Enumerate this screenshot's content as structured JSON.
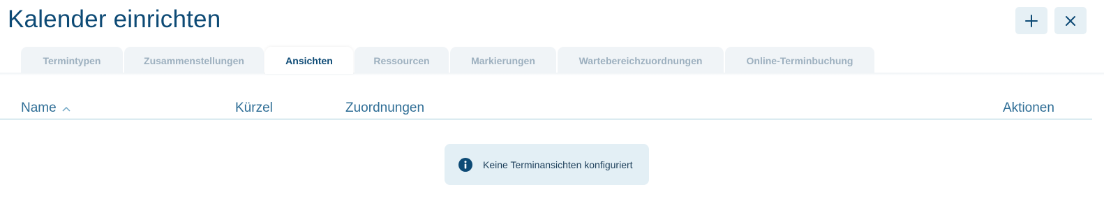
{
  "page": {
    "title": "Kalender einrichten"
  },
  "actions": {
    "add_icon": "plus-icon",
    "close_icon": "close-icon"
  },
  "tabs": [
    {
      "label": "Termintypen",
      "active": false
    },
    {
      "label": "Zusammenstellungen",
      "active": false
    },
    {
      "label": "Ansichten",
      "active": true
    },
    {
      "label": "Ressourcen",
      "active": false
    },
    {
      "label": "Markierungen",
      "active": false
    },
    {
      "label": "Wartebereichzuordnungen",
      "active": false
    },
    {
      "label": "Online-Terminbuchung",
      "active": false
    }
  ],
  "table": {
    "columns": {
      "name": "Name",
      "kurzel": "Kürzel",
      "zuordnungen": "Zuordnungen",
      "aktionen": "Aktionen"
    },
    "sort": {
      "column": "name",
      "direction": "ascending",
      "icon": "chevron-up-icon"
    },
    "rows": []
  },
  "empty_state": {
    "icon": "info-icon",
    "message": "Keine Terminansichten konfiguriert"
  },
  "colors": {
    "primary": "#0d4a75",
    "header_text": "#2f6e96",
    "tab_inactive_bg": "#f0f4f7",
    "tab_inactive_text": "#9db0bf",
    "info_bg": "#e3eff5",
    "button_bg": "#e6f0f5"
  }
}
